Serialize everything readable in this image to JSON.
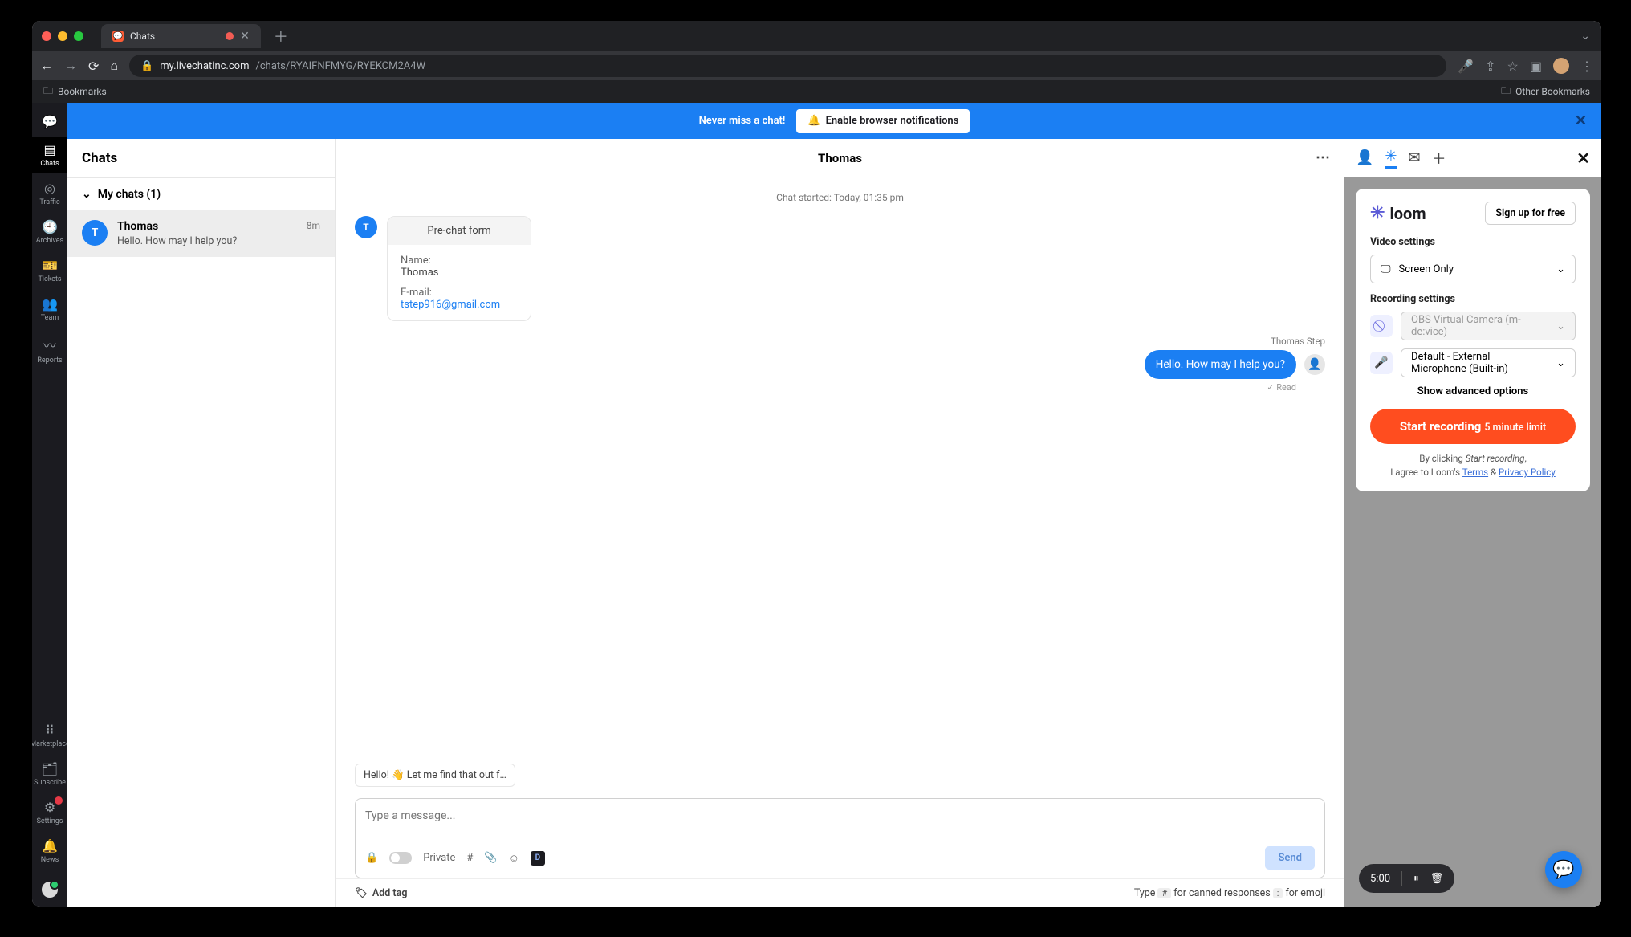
{
  "browser": {
    "tab_title": "Chats",
    "url_host": "my.livechatinc.com",
    "url_path": "/chats/RYAIFNFMYG/RYEKCM2A4W",
    "bookmarks_label": "Bookmarks",
    "other_bookmarks": "Other Bookmarks"
  },
  "navrail": [
    {
      "icon": "💬",
      "label": ""
    },
    {
      "icon": "▤",
      "label": "Chats",
      "active": true
    },
    {
      "icon": "◎",
      "label": "Traffic"
    },
    {
      "icon": "🕘",
      "label": "Archives"
    },
    {
      "icon": "🎫",
      "label": "Tickets"
    },
    {
      "icon": "👥",
      "label": "Team"
    },
    {
      "icon": "〰",
      "label": "Reports"
    }
  ],
  "navrail_bottom": [
    {
      "icon": "⠿",
      "label": "Marketplace"
    },
    {
      "icon": "🗂",
      "label": "Subscribe"
    },
    {
      "icon": "⚙",
      "label": "Settings",
      "badge": true
    },
    {
      "icon": "🔔",
      "label": "News"
    }
  ],
  "banner": {
    "text": "Never miss a chat!",
    "button": "Enable browser notifications"
  },
  "chatlist": {
    "title": "Chats",
    "group": "My chats (1)",
    "item": {
      "initial": "T",
      "name": "Thomas",
      "preview": "Hello. How may I help you?",
      "time": "8m"
    }
  },
  "thread": {
    "title": "Thomas",
    "started": "Chat started: Today, 01:35 pm",
    "prechat": {
      "initial": "T",
      "heading": "Pre-chat form",
      "name_label": "Name:",
      "name_value": "Thomas",
      "email_label": "E-mail:",
      "email_value": "tstep916@gmail.com"
    },
    "self": {
      "from": "Thomas Step",
      "text": "Hello. How may I help you?",
      "read": "Read"
    },
    "suggestion": "Hello! 👋 Let me find that out f…",
    "composer_placeholder": "Type a message...",
    "private_label": "Private",
    "send": "Send",
    "add_tag": "Add tag",
    "hint_prefix": "Type",
    "hint_canned": "for canned responses",
    "hint_emoji": "for emoji"
  },
  "loom": {
    "brand": "loom",
    "signup": "Sign up for free",
    "video_settings": "Video settings",
    "screen_only": "Screen Only",
    "recording_settings": "Recording settings",
    "camera": "OBS Virtual Camera (m-de:vice)",
    "mic": "Default - External Microphone (Built-in)",
    "advanced": "Show advanced options",
    "start": "Start recording",
    "limit": "5 minute limit",
    "disclaimer_1": "By clicking",
    "disclaimer_em": "Start recording",
    "disclaimer_2": "I agree to Loom's",
    "terms": "Terms",
    "and": "&",
    "privacy": "Privacy Policy",
    "timer": "5:00"
  }
}
